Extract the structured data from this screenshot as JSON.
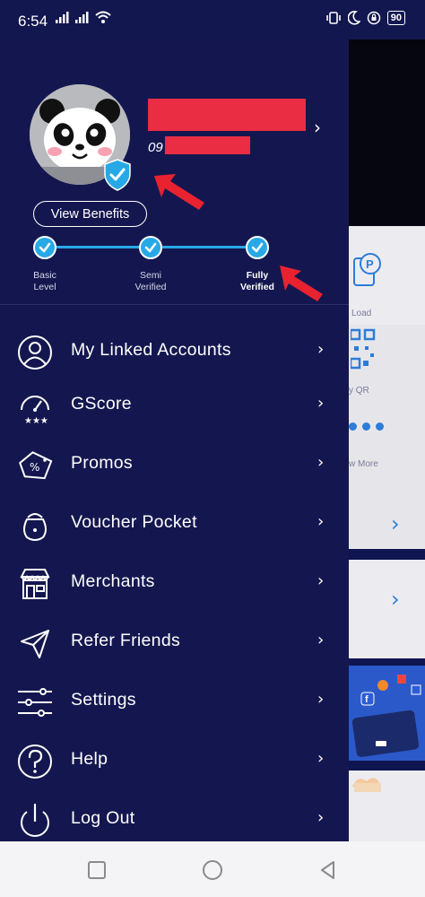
{
  "status_bar": {
    "time": "6:54",
    "battery": "90"
  },
  "profile": {
    "phone_prefix": "09",
    "view_benefits": "View Benefits"
  },
  "verification_steps": [
    {
      "label": "Basic\nLevel",
      "l1": "Basic",
      "l2": "Level"
    },
    {
      "label": "Semi\nVerified",
      "l1": "Semi",
      "l2": "Verified"
    },
    {
      "label": "Fully\nVerified",
      "l1": "Fully",
      "l2": "Verified"
    }
  ],
  "menu": [
    {
      "label": "My Linked Accounts",
      "icon": "user-circle-icon"
    },
    {
      "label": "GScore",
      "icon": "speedometer-stars-icon"
    },
    {
      "label": "Promos",
      "icon": "percent-tag-icon"
    },
    {
      "label": "Voucher Pocket",
      "icon": "voucher-pouch-icon"
    },
    {
      "label": "Merchants",
      "icon": "storefront-icon"
    },
    {
      "label": "Refer Friends",
      "icon": "paper-plane-icon"
    },
    {
      "label": "Settings",
      "icon": "sliders-icon"
    },
    {
      "label": "Help",
      "icon": "question-circle-icon"
    },
    {
      "label": "Log Out",
      "icon": "power-icon"
    }
  ],
  "background_app": {
    "load_label": "Load",
    "qr_label": "y QR",
    "more_label": "w More"
  },
  "colors": {
    "drawer_bg": "#14174f",
    "accent_blue": "#28a9e7",
    "redaction_red": "#ea2d43",
    "annotation_arrow": "#e8232f"
  }
}
